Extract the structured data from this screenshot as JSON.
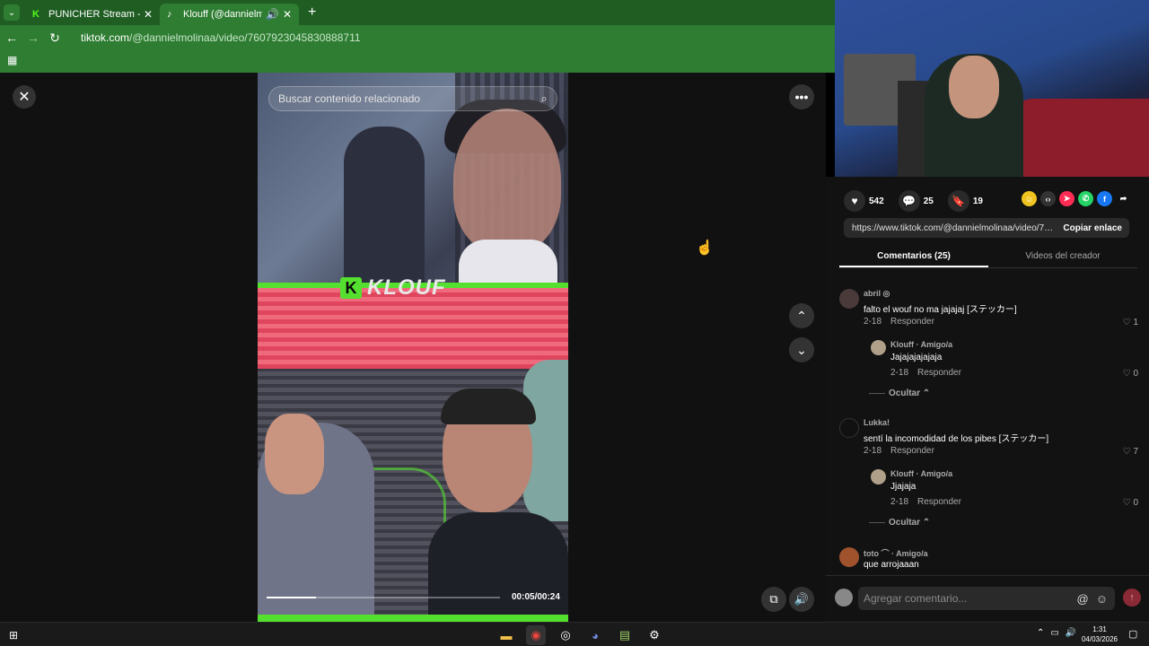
{
  "browser": {
    "tabs": [
      {
        "label": "PUNICHER Stream - Watch Live",
        "icon": "kick-logo",
        "color": "#53fc18"
      },
      {
        "label": "Klouff (@dannielmolinaa) |",
        "icon": "tiktok-logo"
      }
    ],
    "url_host": "tiktok.com",
    "url_path": "/@dannielmolinaa/video/7607923045830888711",
    "accent": "#2e7d32"
  },
  "player": {
    "search_placeholder": "Buscar contenido relacionado",
    "video_logo": "KLOUF",
    "time": "00:05/00:24",
    "progress_fraction": 0.21
  },
  "panel": {
    "likes": "542",
    "comments_count": "25",
    "bookmarks": "19",
    "share_link": "https://www.tiktok.com/@dannielmolinaa/video/76...",
    "copy_label": "Copiar enlace",
    "tab_comments": "Comentarios (25)",
    "tab_creator": "Videos del creador",
    "comments": [
      {
        "user": "abril ◎",
        "text": "falto el wouf no ma jajajaj [ステッカー]",
        "date": "2-18",
        "reply": "Responder",
        "likes": "1"
      },
      {
        "user": "Klouff · Amigo/a",
        "text": "Jajajajajajaja",
        "date": "2-18",
        "reply": "Responder",
        "likes": "0"
      },
      {
        "user": "Lukka!",
        "text": "sentí la incomodidad de los pibes [ステッカー]",
        "date": "2-18",
        "reply": "Responder",
        "likes": "7"
      },
      {
        "user": "Klouff · Amigo/a",
        "text": "Jjajaja",
        "date": "2-18",
        "reply": "Responder",
        "likes": "0"
      },
      {
        "user": "toto ⌒ · Amigo/a",
        "text": "que arrojaaan",
        "date": "",
        "reply": "",
        "likes": ""
      }
    ],
    "hide_label": "Ocultar",
    "composer_placeholder": "Agregar comentario..."
  },
  "taskbar": {
    "time": "1:31",
    "date": "04/03/2026"
  }
}
